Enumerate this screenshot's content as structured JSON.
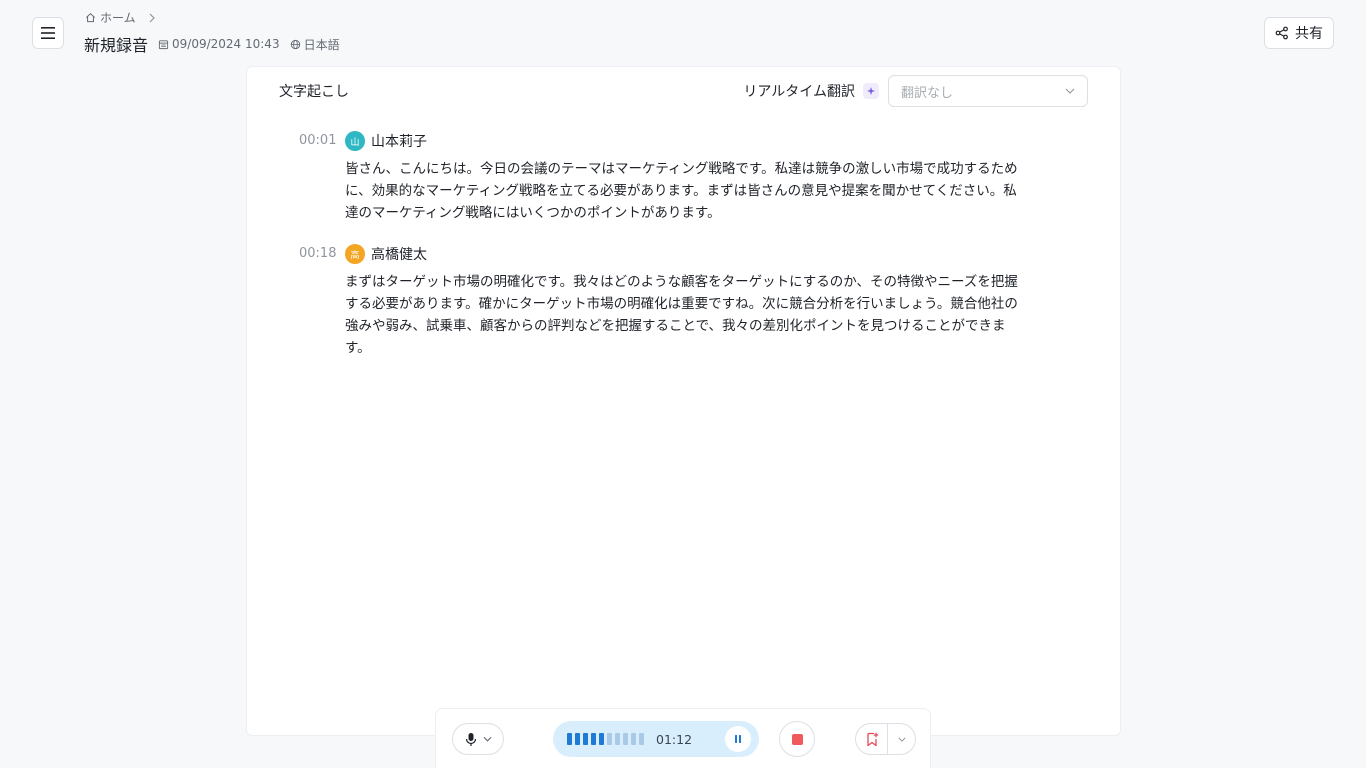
{
  "header": {
    "breadcrumb_home": "ホーム",
    "title": "新規録音",
    "date": "09/09/2024 10:43",
    "language": "日本語",
    "share_label": "共有"
  },
  "transcript": {
    "title": "文字起こし",
    "realtime_translation_label": "リアルタイム翻訳",
    "translation_select": {
      "value": "翻訳なし"
    },
    "entries": [
      {
        "timestamp": "00:01",
        "speaker": "山本莉子",
        "avatar": "山",
        "avatar_color": "#2fb8c4",
        "text": "皆さん、こんにちは。今日の会議のテーマはマーケティング戦略です。私達は競争の激しい市場で成功するために、効果的なマーケティング戦略を立てる必要があります。まずは皆さんの意見や提案を聞かせてください。私達のマーケティング戦略にはいくつかのポイントがあります。"
      },
      {
        "timestamp": "00:18",
        "speaker": "高橋健太",
        "avatar": "高",
        "avatar_color": "#f5a524",
        "text": "まずはターゲット市場の明確化です。我々はどのような顧客をターゲットにするのか、その特徴やニーズを把握する必要があります。確かにターゲット市場の明確化は重要ですね。次に競合分析を行いましょう。競合他社の強みや弱み、試乗車、顧客からの評判などを把握することで、我々の差別化ポイントを見つけることができます。"
      }
    ]
  },
  "recorder": {
    "elapsed": "01:12",
    "level_bars_active": 5,
    "level_bars_total": 10,
    "accent_color": "#1f7ad6"
  }
}
